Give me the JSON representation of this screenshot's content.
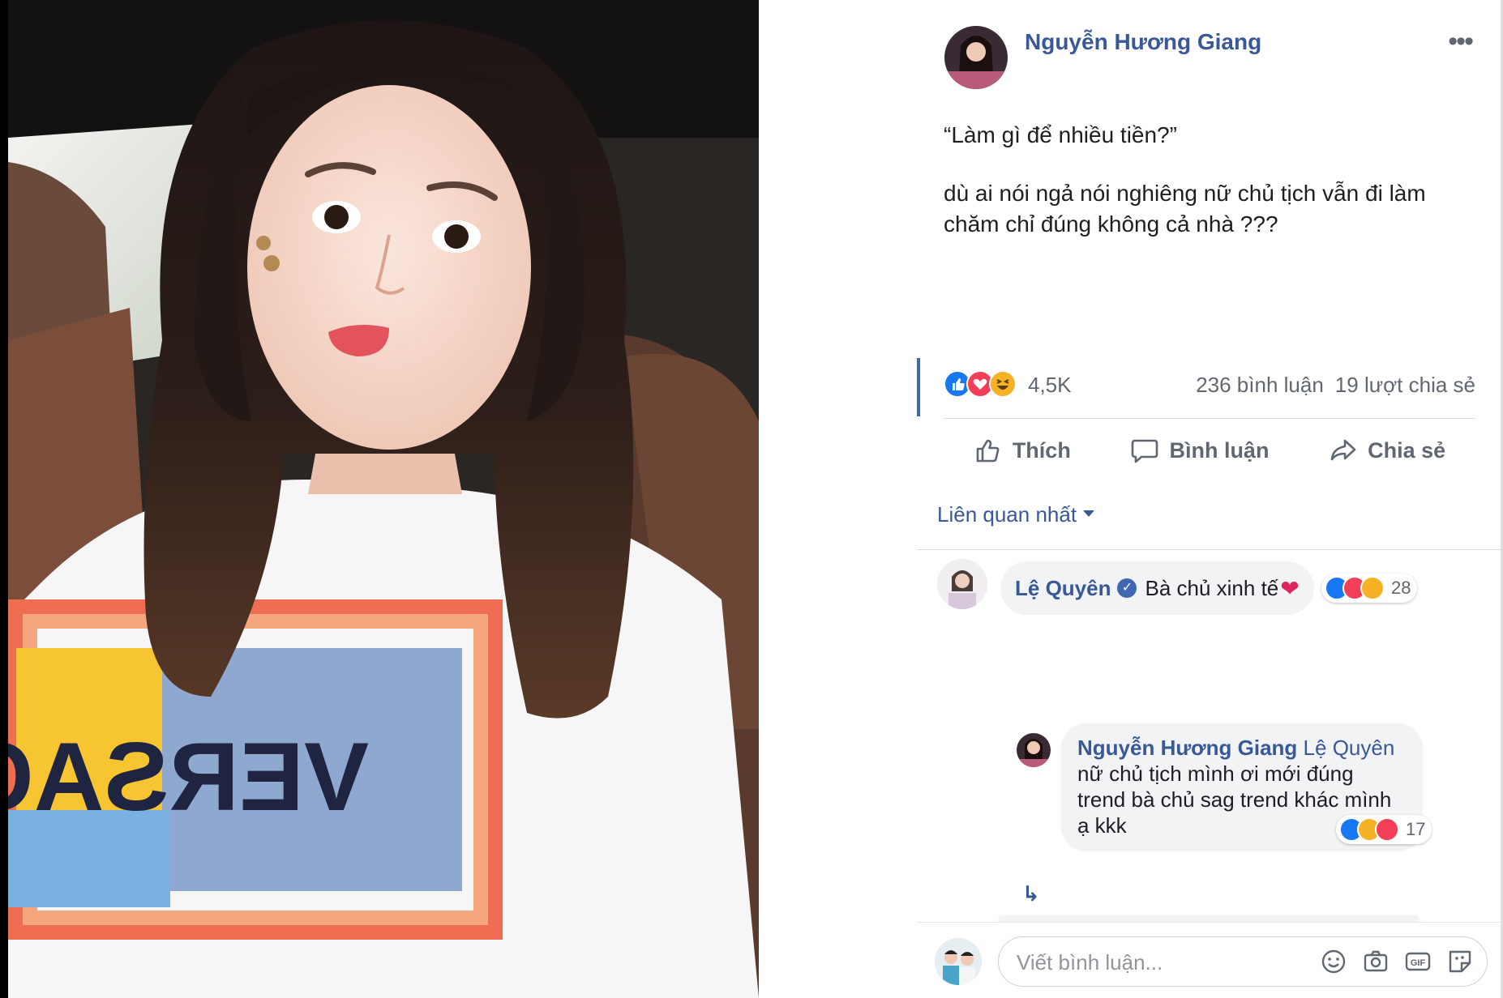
{
  "post": {
    "author": "Nguyễn Hương Giang",
    "more_label": "•••",
    "text_line1": "“Làm gì để nhiều tiền?”",
    "text_line2": "dù ai nói ngả nói nghiêng nữ chủ tịch vẫn đi làm chăm chỉ đúng không cả nhà ???",
    "reaction_count": "4,5K",
    "comments_count": "236 bình luận",
    "shares_count": "19 lượt chia sẻ"
  },
  "actions": {
    "like": "Thích",
    "comment": "Bình luận",
    "share": "Chia sẻ"
  },
  "sort": {
    "label": "Liên quan nhất"
  },
  "comments": [
    {
      "name": "Lệ Quyên",
      "text": "Bà chủ xinh tế",
      "reaction_count": "28"
    }
  ],
  "reply": {
    "name": "Nguyễn Hương Giang",
    "mention": "Lệ Quyên",
    "text": "nữ chủ tịch mình ơi mới đúng trend bà chủ sag trend khác mình ạ kkk",
    "reaction_count": "17"
  },
  "composer": {
    "placeholder": "Viết bình luận..."
  },
  "photo": {
    "shirt_text": "VERSACE"
  },
  "colors": {
    "link_blue": "#385898",
    "like_blue": "#1877f2",
    "love_red": "#f33e58",
    "haha_yellow": "#f7b125",
    "muted": "#606770",
    "bubble_bg": "#f2f3f5"
  }
}
